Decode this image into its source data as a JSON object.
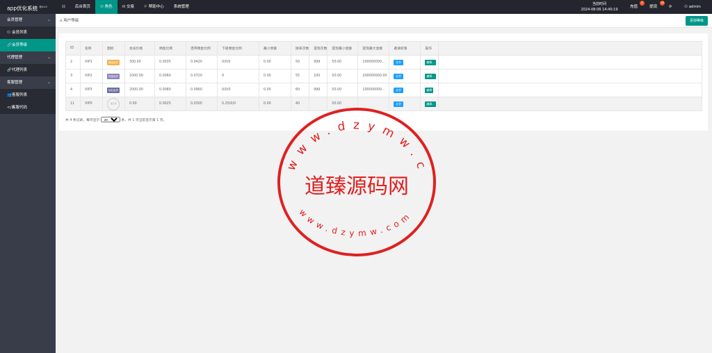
{
  "app": {
    "title": "app优化系统",
    "version": "@v1.0"
  },
  "topnav": {
    "menu_icon": "grid-icon",
    "items": [
      {
        "label": "后台首页",
        "icon": ""
      },
      {
        "label": "角色",
        "icon": "user-icon"
      },
      {
        "label": "交易",
        "icon": "database-icon"
      },
      {
        "label": "帮助中心",
        "icon": "flag-icon"
      },
      {
        "label": "系统管理",
        "icon": ""
      }
    ]
  },
  "topright": {
    "time_label": "当前时间",
    "time_value": "2024-08-06 14:40:19",
    "recharge_label": "充值",
    "recharge_count": "0",
    "withdraw_label": "提现",
    "withdraw_count": "16",
    "user": "admin"
  },
  "sidebar": {
    "groups": [
      {
        "label": "会员管理",
        "items": [
          {
            "label": "会员列表",
            "icon": "user-icon"
          },
          {
            "label": "会员等级",
            "icon": "link-icon"
          }
        ]
      },
      {
        "label": "代理管理",
        "items": [
          {
            "label": "代理列表",
            "icon": "link-icon"
          }
        ]
      },
      {
        "label": "客服管理",
        "items": [
          {
            "label": "客服列表",
            "icon": "users-icon"
          },
          {
            "label": "客服代码",
            "icon": "code-icon"
          }
        ]
      }
    ]
  },
  "breadcrumb": "用户等级",
  "add_button": "添加等级",
  "table": {
    "columns": [
      "ID",
      "名称",
      "图标",
      "会员价格",
      "佣金比例",
      "连带佣金比例",
      "下级佣金比例",
      "最小余额",
      "接单次数",
      "提现次数",
      "提现最小金额",
      "提现最大金额",
      "邀请权限",
      "操作"
    ],
    "rows": [
      {
        "id": "2",
        "name": "VIP1",
        "icon_text": "黄金会员",
        "icon_color": "#f0b24d",
        "price": "300.00",
        "commission": "0.0035",
        "joint": "0.0420",
        "sub": "0/0/0",
        "min_balance": "0.00",
        "orders": "50",
        "withdraw_times": "999",
        "withdraw_min": "50.00",
        "withdraw_max": "100000000...",
        "perm": "允许",
        "action": "编辑..."
      },
      {
        "id": "3",
        "name": "VIP2",
        "icon_text": "铂金会员",
        "icon_color": "#8d84b8",
        "price": "1000.00",
        "commission": "0.0060",
        "joint": "0.0720",
        "sub": "0",
        "min_balance": "0.00",
        "orders": "55",
        "withdraw_times": "100",
        "withdraw_min": "50.00",
        "withdraw_max": "200000000.00",
        "perm": "允许",
        "action": "编辑..."
      },
      {
        "id": "4",
        "name": "VIP3",
        "icon_text": "钻石会员",
        "icon_color": "#6b6f9e",
        "price": "2000.00",
        "commission": "0.0080",
        "joint": "0.0960",
        "sub": "0/0/0",
        "min_balance": "0.00",
        "orders": "60",
        "withdraw_times": "999",
        "withdraw_min": "50.00",
        "withdraw_max": "100000000...",
        "perm": "允许",
        "action": "编辑"
      },
      {
        "id": "11",
        "name": "VIP0",
        "icon_text": "404",
        "icon_color": "",
        "price": "0.00",
        "commission": "0.0025",
        "joint": "0.0300",
        "sub": "0.25/0/0",
        "min_balance": "0.00",
        "orders": "40",
        "withdraw_times": "",
        "withdraw_min": "50.00",
        "withdraw_max": "",
        "perm": "允许",
        "action": "编辑..."
      }
    ]
  },
  "pager": {
    "prefix": "共 4 条记录，每页显示",
    "page_size": "20",
    "suffix": "条，共 1 页当前显示第 1 页。"
  },
  "watermark": {
    "top_text": "www.dzymw.com",
    "center_text": "道臻源码网",
    "bottom_text": "www.dzymw.com",
    "color": "#e02020"
  }
}
